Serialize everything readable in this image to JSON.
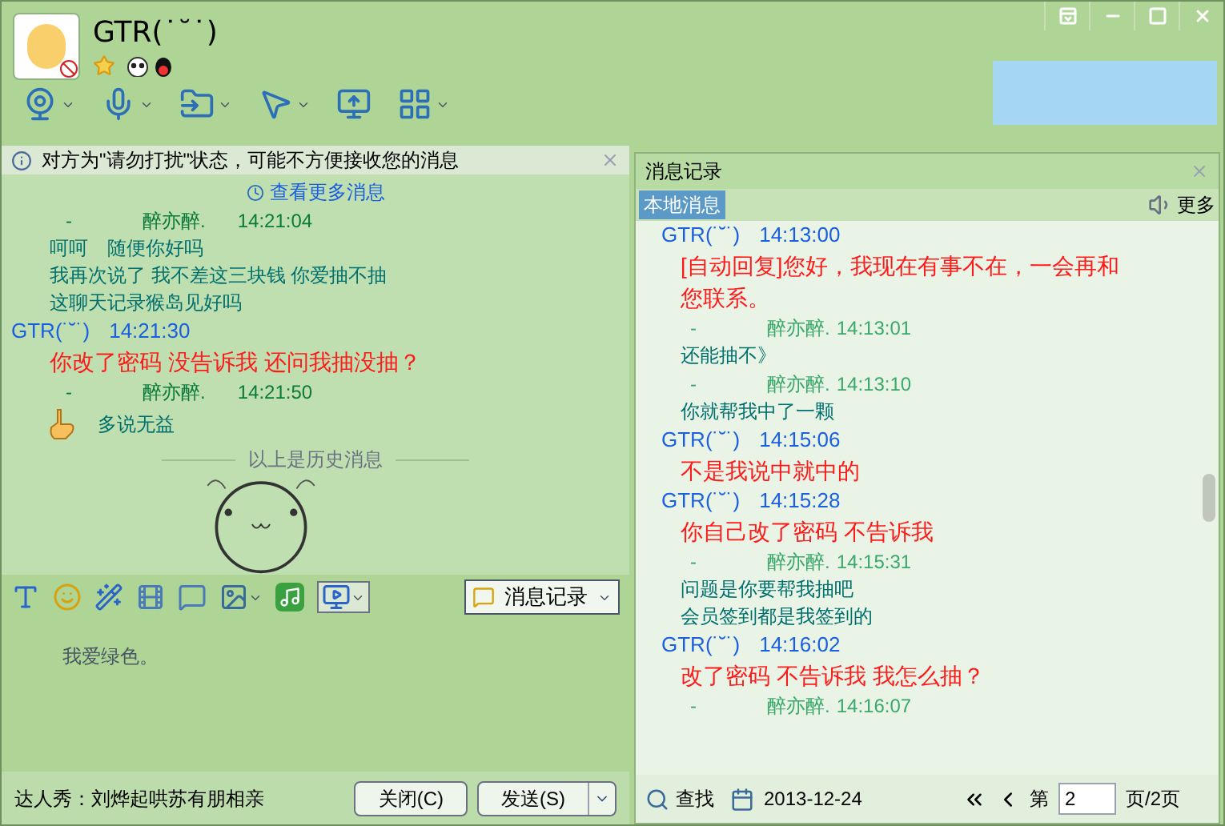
{
  "contact": {
    "name": "GTR(˙˘˙)"
  },
  "notice": {
    "text": "对方为\"请勿打扰\"状态，可能不方便接收您的消息"
  },
  "chat": {
    "more_link": "查看更多消息",
    "messages": [
      {
        "kind": "self",
        "marker": "-",
        "name": "醉亦醉.",
        "time": "14:21:04",
        "lines": [
          "呵呵　随便你好吗",
          "我再次说了 我不差这三块钱 你爱抽不抽",
          "这聊天记录猴岛见好吗"
        ]
      },
      {
        "kind": "peer",
        "name": "GTR(˙˘˙)",
        "time": "14:21:30",
        "lines": [
          "你改了密码 没告诉我 还问我抽没抽？"
        ]
      },
      {
        "kind": "self",
        "marker": "-",
        "name": "醉亦醉.",
        "time": "14:21:50",
        "emoticon": true,
        "lines": [
          "多说无益"
        ]
      }
    ],
    "history_divider": "以上是历史消息"
  },
  "draft": {
    "value": "我爱绿色。"
  },
  "history_button": "消息记录",
  "footer": {
    "promo_link": "达人秀：刘烨起哄苏有朋相亲",
    "buttons": [
      {
        "label": "关闭(C)",
        "dropdown": false
      },
      {
        "label": "发送(S)",
        "dropdown": true
      }
    ]
  },
  "log": {
    "title": "消息记录",
    "tabs": [
      {
        "label": "本地消息",
        "selected": true
      }
    ],
    "more": "更多",
    "messages": [
      {
        "kind": "peer",
        "name": "GTR(˙˘˙)",
        "time": "14:13:00",
        "lines": [
          "[自动回复]您好，我现在有事不在，一会再和您联系。"
        ]
      },
      {
        "kind": "self",
        "marker": "-",
        "name": "醉亦醉.",
        "time": "14:13:01",
        "lines": [
          "还能抽不》"
        ]
      },
      {
        "kind": "self",
        "marker": "-",
        "name": "醉亦醉.",
        "time": "14:13:10",
        "lines": [
          "你就帮我中了一颗"
        ]
      },
      {
        "kind": "peer",
        "name": "GTR(˙˘˙)",
        "time": "14:15:06",
        "lines": [
          "不是我说中就中的"
        ]
      },
      {
        "kind": "peer",
        "name": "GTR(˙˘˙)",
        "time": "14:15:28",
        "lines": [
          "你自己改了密码 不告诉我"
        ]
      },
      {
        "kind": "self",
        "marker": "-",
        "name": "醉亦醉.",
        "time": "14:15:31",
        "lines": [
          "问题是你要帮我抽吧",
          "会员签到都是我签到的"
        ]
      },
      {
        "kind": "peer",
        "name": "GTR(˙˘˙)",
        "time": "14:16:02",
        "lines": [
          "改了密码 不告诉我 我怎么抽？"
        ]
      },
      {
        "kind": "self",
        "marker": "-",
        "name": "醉亦醉.",
        "time": "14:16:07"
      }
    ],
    "search": "查找",
    "date": "2013-12-24",
    "page_prefix": "第",
    "page": "2",
    "page_suffix": "页/2页"
  }
}
